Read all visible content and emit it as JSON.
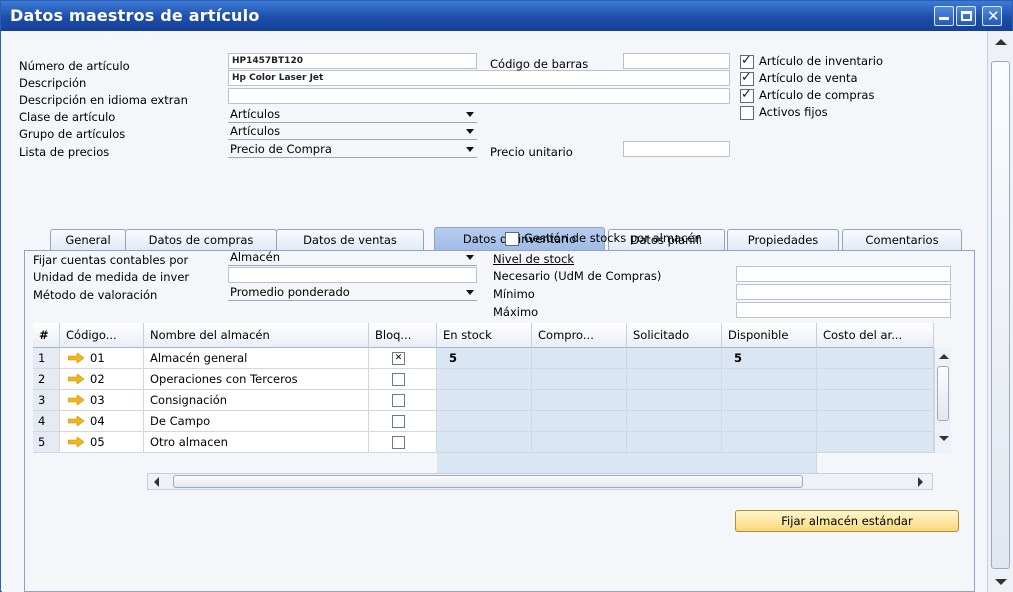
{
  "window": {
    "title": "Datos maestros de artículo"
  },
  "header": {
    "item_number_label": "Número de artículo",
    "item_number_value": "HP1457BT120",
    "description_label": "Descripción",
    "description_value": "Hp Color Laser Jet",
    "foreign_description_label": "Descripción en idioma extran",
    "foreign_description_value": "",
    "item_type_label": "Clase de artículo",
    "item_type_value": "Artículos",
    "item_group_label": "Grupo de artículos",
    "item_group_value": "Artículos",
    "price_list_label": "Lista de precios",
    "price_list_value": "Precio de Compra",
    "barcode_label": "Código de barras",
    "barcode_value": "",
    "unit_price_label": "Precio unitario",
    "unit_price_value": "",
    "checkboxes": [
      {
        "label": "Artículo de inventario",
        "checked": true
      },
      {
        "label": "Artículo de venta",
        "checked": true
      },
      {
        "label": "Artículo de compras",
        "checked": true
      },
      {
        "label": "Activos fijos",
        "checked": false
      }
    ]
  },
  "tabs": [
    {
      "label": "General",
      "active": false
    },
    {
      "label": "Datos de compras",
      "active": false
    },
    {
      "label": "Datos de ventas",
      "active": false
    },
    {
      "label": "Datos de inventario",
      "active": true
    },
    {
      "label": "Datos planif.",
      "active": false
    },
    {
      "label": "Propiedades",
      "active": false
    },
    {
      "label": "Comentarios",
      "active": false
    }
  ],
  "inventory": {
    "manage_by_warehouse_label": "Gestión de stocks por almacén",
    "manage_by_warehouse_checked": false,
    "gl_method_label": "Fijar cuentas contables por",
    "gl_method_value": "Almacén",
    "uom_label": "Unidad de medida de inver",
    "uom_value": "",
    "valuation_label": "Método de valoración",
    "valuation_value": "Promedio ponderado",
    "stock_level_label": "Nivel de stock",
    "required_label": "Necesario (UdM de Compras)",
    "required_value": "",
    "min_label": "Mínimo",
    "min_value": "",
    "max_label": "Máximo",
    "max_value": ""
  },
  "grid": {
    "columns": [
      "#",
      "Código...",
      "Nombre del almacén",
      "Bloq...",
      "En stock",
      "Compro...",
      "Solicitado",
      "Disponible",
      "Costo del ar..."
    ],
    "rows": [
      {
        "num": "1",
        "code": "01",
        "name": "Almacén general",
        "locked": true,
        "in_stock": "5",
        "committed": "",
        "ordered": "",
        "available": "5",
        "cost": ""
      },
      {
        "num": "2",
        "code": "02",
        "name": "Operaciones con Terceros",
        "locked": false,
        "in_stock": "",
        "committed": "",
        "ordered": "",
        "available": "",
        "cost": ""
      },
      {
        "num": "3",
        "code": "03",
        "name": "Consignación",
        "locked": false,
        "in_stock": "",
        "committed": "",
        "ordered": "",
        "available": "",
        "cost": ""
      },
      {
        "num": "4",
        "code": "04",
        "name": "De Campo",
        "locked": false,
        "in_stock": "",
        "committed": "",
        "ordered": "",
        "available": "",
        "cost": ""
      },
      {
        "num": "5",
        "code": "05",
        "name": "Otro almacen",
        "locked": false,
        "in_stock": "",
        "committed": "",
        "ordered": "",
        "available": "",
        "cost": ""
      }
    ]
  },
  "buttons": {
    "set_default_warehouse": "Fijar almacén estándar"
  },
  "colors": {
    "title_bar": "#1d4ea8",
    "active_tab": "#a9c3ea",
    "button_yellow": "#f7d97a",
    "link_arrow": "#f2b51c"
  }
}
